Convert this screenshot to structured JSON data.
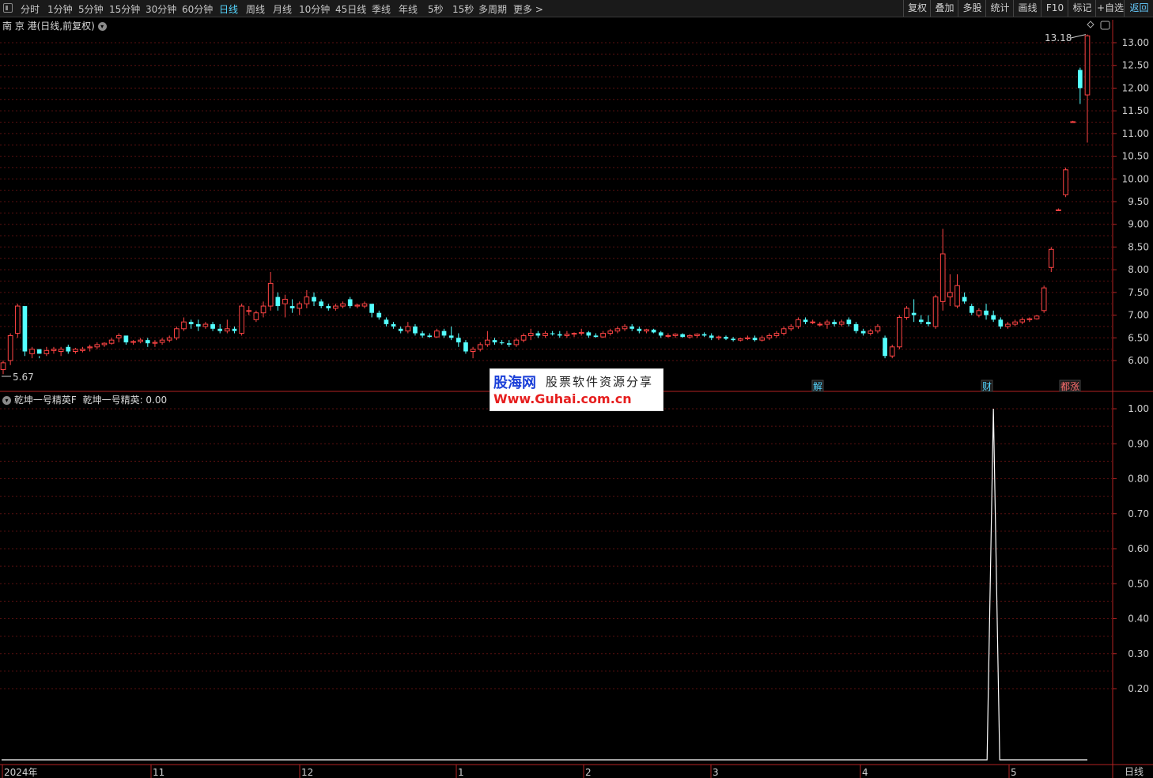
{
  "toolbar": {
    "periods": [
      "分时",
      "1分钟",
      "5分钟",
      "15分钟",
      "30分钟",
      "60分钟",
      "日线",
      "周线",
      "月线",
      "10分钟",
      "45日线",
      "季线",
      "年线",
      "5秒",
      "15秒",
      "多周期",
      "更多 >"
    ],
    "active_period": "日线",
    "right_buttons": [
      "复权",
      "叠加",
      "多股",
      "统计",
      "画线",
      "F10",
      "标记",
      "+自选",
      "返回"
    ]
  },
  "main_chart": {
    "stock_title": "南 京 港(日线,前复权)",
    "high_label": "13.18",
    "low_label": "5.67",
    "markers": [
      "解",
      "财",
      "都涨"
    ],
    "price_scale": [
      "13.00",
      "12.50",
      "12.00",
      "11.50",
      "11.00",
      "10.50",
      "10.00",
      "9.50",
      "9.00",
      "8.50",
      "8.00",
      "7.50",
      "7.00",
      "6.50",
      "6.00"
    ]
  },
  "indicator": {
    "name": "乾坤一号精英F",
    "value_text": "乾坤一号精英: 0.00",
    "scale": [
      "1.00",
      "0.90",
      "0.80",
      "0.70",
      "0.60",
      "0.50",
      "0.40",
      "0.30",
      "0.20"
    ]
  },
  "time_axis": [
    "2024年",
    "11",
    "12",
    "1",
    "2",
    "3",
    "4",
    "5"
  ],
  "period_label": "日线",
  "watermark": {
    "logo": "股海网",
    "slogan": "股票软件资源分享",
    "url": "Www.Guhai.com.cn"
  },
  "colors": {
    "up": "#ff4444",
    "down": "#54ffff",
    "grid": "#5a1010",
    "border": "#b22222",
    "background": "#000000",
    "active_tab": "#55d6ff"
  },
  "chart_data": [
    {
      "type": "candlestick",
      "title": "南 京 港(日线,前复权)",
      "ylim": [
        5.8,
        13.3
      ],
      "x_ticks": [
        "2024年",
        "11",
        "12",
        "1",
        "2",
        "3",
        "4",
        "5"
      ],
      "candles": [
        [
          5.8,
          6.0,
          5.7,
          5.95
        ],
        [
          6.0,
          6.6,
          5.9,
          6.55
        ],
        [
          6.6,
          7.25,
          6.5,
          7.2
        ],
        [
          7.2,
          6.7,
          6.1,
          6.2
        ],
        [
          6.15,
          6.3,
          6.05,
          6.25
        ],
        [
          6.25,
          6.1,
          6.05,
          6.15
        ],
        [
          6.15,
          6.3,
          6.1,
          6.22
        ],
        [
          6.22,
          6.3,
          6.15,
          6.25
        ],
        [
          6.2,
          6.3,
          6.1,
          6.25
        ],
        [
          6.3,
          6.35,
          6.15,
          6.2
        ],
        [
          6.2,
          6.28,
          6.15,
          6.25
        ],
        [
          6.22,
          6.3,
          6.18,
          6.25
        ],
        [
          6.28,
          6.35,
          6.2,
          6.3
        ],
        [
          6.3,
          6.4,
          6.25,
          6.35
        ],
        [
          6.35,
          6.4,
          6.3,
          6.38
        ],
        [
          6.38,
          6.5,
          6.35,
          6.45
        ],
        [
          6.5,
          6.6,
          6.4,
          6.55
        ],
        [
          6.55,
          6.5,
          6.35,
          6.4
        ],
        [
          6.4,
          6.45,
          6.35,
          6.42
        ],
        [
          6.42,
          6.5,
          6.38,
          6.45
        ],
        [
          6.45,
          6.5,
          6.3,
          6.38
        ],
        [
          6.38,
          6.45,
          6.3,
          6.4
        ],
        [
          6.4,
          6.5,
          6.35,
          6.45
        ],
        [
          6.45,
          6.55,
          6.4,
          6.5
        ],
        [
          6.5,
          6.75,
          6.45,
          6.7
        ],
        [
          6.7,
          6.95,
          6.65,
          6.85
        ],
        [
          6.85,
          6.9,
          6.7,
          6.8
        ],
        [
          6.8,
          6.9,
          6.65,
          6.75
        ],
        [
          6.75,
          6.85,
          6.7,
          6.8
        ],
        [
          6.8,
          6.85,
          6.65,
          6.7
        ],
        [
          6.7,
          6.8,
          6.6,
          6.65
        ],
        [
          6.65,
          6.9,
          6.6,
          6.7
        ],
        [
          6.7,
          6.75,
          6.6,
          6.65
        ],
        [
          6.6,
          7.25,
          6.55,
          7.2
        ],
        [
          7.1,
          7.2,
          7.0,
          7.1
        ],
        [
          6.9,
          7.1,
          6.85,
          7.05
        ],
        [
          7.05,
          7.3,
          6.95,
          7.2
        ],
        [
          7.2,
          7.95,
          7.1,
          7.7
        ],
        [
          7.4,
          7.5,
          7.1,
          7.2
        ],
        [
          7.25,
          7.45,
          6.95,
          7.35
        ],
        [
          7.2,
          7.35,
          7.05,
          7.15
        ],
        [
          7.15,
          7.3,
          7.0,
          7.25
        ],
        [
          7.25,
          7.55,
          7.15,
          7.4
        ],
        [
          7.4,
          7.5,
          7.2,
          7.3
        ],
        [
          7.3,
          7.35,
          7.15,
          7.2
        ],
        [
          7.2,
          7.25,
          7.1,
          7.15
        ],
        [
          7.15,
          7.25,
          7.1,
          7.2
        ],
        [
          7.2,
          7.3,
          7.15,
          7.25
        ],
        [
          7.35,
          7.4,
          7.15,
          7.2
        ],
        [
          7.2,
          7.25,
          7.15,
          7.22
        ],
        [
          7.2,
          7.3,
          7.15,
          7.25
        ],
        [
          7.25,
          7.2,
          6.95,
          7.05
        ],
        [
          7.05,
          7.1,
          6.9,
          6.95
        ],
        [
          6.9,
          6.95,
          6.75,
          6.8
        ],
        [
          6.8,
          6.85,
          6.7,
          6.75
        ],
        [
          6.7,
          6.75,
          6.6,
          6.65
        ],
        [
          6.65,
          6.85,
          6.6,
          6.75
        ],
        [
          6.75,
          6.8,
          6.55,
          6.6
        ],
        [
          6.6,
          6.65,
          6.5,
          6.55
        ],
        [
          6.55,
          6.6,
          6.5,
          6.52
        ],
        [
          6.52,
          6.7,
          6.5,
          6.65
        ],
        [
          6.65,
          6.7,
          6.5,
          6.55
        ],
        [
          6.55,
          6.75,
          6.45,
          6.5
        ],
        [
          6.5,
          6.6,
          6.3,
          6.4
        ],
        [
          6.4,
          6.45,
          6.15,
          6.2
        ],
        [
          6.2,
          6.3,
          6.05,
          6.25
        ],
        [
          6.25,
          6.4,
          6.2,
          6.35
        ],
        [
          6.35,
          6.65,
          6.3,
          6.45
        ],
        [
          6.45,
          6.5,
          6.35,
          6.4
        ],
        [
          6.4,
          6.45,
          6.35,
          6.38
        ],
        [
          6.38,
          6.45,
          6.3,
          6.35
        ],
        [
          6.35,
          6.5,
          6.3,
          6.45
        ],
        [
          6.45,
          6.6,
          6.4,
          6.55
        ],
        [
          6.55,
          6.7,
          6.45,
          6.6
        ],
        [
          6.6,
          6.65,
          6.5,
          6.55
        ],
        [
          6.55,
          6.65,
          6.5,
          6.6
        ],
        [
          6.6,
          6.65,
          6.55,
          6.58
        ],
        [
          6.58,
          6.65,
          6.5,
          6.55
        ],
        [
          6.55,
          6.65,
          6.5,
          6.58
        ],
        [
          6.58,
          6.62,
          6.52,
          6.6
        ],
        [
          6.6,
          6.7,
          6.55,
          6.62
        ],
        [
          6.62,
          6.65,
          6.5,
          6.55
        ],
        [
          6.55,
          6.6,
          6.5,
          6.52
        ],
        [
          6.52,
          6.65,
          6.5,
          6.6
        ],
        [
          6.6,
          6.7,
          6.55,
          6.65
        ],
        [
          6.65,
          6.75,
          6.6,
          6.7
        ],
        [
          6.7,
          6.8,
          6.65,
          6.75
        ],
        [
          6.75,
          6.8,
          6.65,
          6.7
        ],
        [
          6.7,
          6.75,
          6.6,
          6.65
        ],
        [
          6.65,
          6.7,
          6.6,
          6.68
        ],
        [
          6.68,
          6.7,
          6.6,
          6.62
        ],
        [
          6.62,
          6.65,
          6.5,
          6.55
        ],
        [
          6.55,
          6.6,
          6.5,
          6.55
        ],
        [
          6.55,
          6.6,
          6.5,
          6.58
        ],
        [
          6.58,
          6.6,
          6.5,
          6.52
        ],
        [
          6.52,
          6.58,
          6.48,
          6.55
        ],
        [
          6.55,
          6.6,
          6.5,
          6.58
        ],
        [
          6.58,
          6.62,
          6.52,
          6.55
        ],
        [
          6.55,
          6.6,
          6.45,
          6.5
        ],
        [
          6.5,
          6.55,
          6.45,
          6.52
        ],
        [
          6.52,
          6.55,
          6.45,
          6.48
        ],
        [
          6.48,
          6.52,
          6.42,
          6.45
        ],
        [
          6.45,
          6.5,
          6.42,
          6.48
        ],
        [
          6.48,
          6.55,
          6.45,
          6.5
        ],
        [
          6.5,
          6.55,
          6.42,
          6.45
        ],
        [
          6.45,
          6.55,
          6.42,
          6.5
        ],
        [
          6.5,
          6.6,
          6.45,
          6.55
        ],
        [
          6.55,
          6.65,
          6.5,
          6.6
        ],
        [
          6.6,
          6.75,
          6.55,
          6.7
        ],
        [
          6.7,
          6.8,
          6.65,
          6.75
        ],
        [
          6.75,
          6.95,
          6.7,
          6.9
        ],
        [
          6.9,
          6.95,
          6.8,
          6.85
        ],
        [
          6.85,
          6.9,
          6.8,
          6.85
        ],
        [
          6.8,
          6.85,
          6.75,
          6.8
        ],
        [
          6.8,
          6.9,
          6.7,
          6.85
        ],
        [
          6.85,
          6.9,
          6.75,
          6.8
        ],
        [
          6.8,
          6.9,
          6.75,
          6.85
        ],
        [
          6.9,
          6.95,
          6.75,
          6.8
        ],
        [
          6.8,
          6.85,
          6.6,
          6.65
        ],
        [
          6.65,
          6.7,
          6.55,
          6.6
        ],
        [
          6.6,
          6.7,
          6.55,
          6.65
        ],
        [
          6.65,
          6.8,
          6.6,
          6.75
        ],
        [
          6.5,
          6.55,
          6.05,
          6.1
        ],
        [
          6.1,
          6.35,
          6.05,
          6.3
        ],
        [
          6.3,
          7.0,
          6.25,
          6.95
        ],
        [
          6.95,
          7.2,
          6.9,
          7.15
        ],
        [
          7.05,
          7.35,
          6.85,
          7.0
        ],
        [
          6.9,
          7.0,
          6.8,
          6.85
        ],
        [
          6.85,
          7.0,
          6.75,
          6.8
        ],
        [
          6.75,
          7.45,
          6.7,
          7.4
        ],
        [
          7.3,
          8.9,
          7.1,
          8.35
        ],
        [
          7.4,
          7.9,
          7.2,
          7.5
        ],
        [
          7.2,
          7.9,
          7.15,
          7.65
        ],
        [
          7.4,
          7.5,
          7.25,
          7.3
        ],
        [
          7.2,
          7.25,
          7.0,
          7.05
        ],
        [
          7.0,
          7.15,
          6.95,
          7.1
        ],
        [
          7.1,
          7.25,
          6.9,
          7.0
        ],
        [
          7.0,
          7.1,
          6.85,
          6.9
        ],
        [
          6.9,
          6.95,
          6.7,
          6.75
        ],
        [
          6.75,
          6.85,
          6.7,
          6.8
        ],
        [
          6.8,
          6.9,
          6.75,
          6.85
        ],
        [
          6.85,
          6.95,
          6.8,
          6.9
        ],
        [
          6.9,
          6.95,
          6.85,
          6.92
        ],
        [
          6.92,
          7.0,
          6.9,
          6.98
        ],
        [
          7.1,
          7.65,
          7.05,
          7.6
        ],
        [
          8.05,
          8.5,
          7.95,
          8.45
        ],
        [
          9.3,
          9.35,
          9.3,
          9.32
        ],
        [
          9.65,
          10.25,
          9.6,
          10.2
        ],
        [
          11.25,
          11.28,
          11.25,
          11.26
        ],
        [
          12.4,
          12.45,
          11.65,
          12.0
        ],
        [
          11.85,
          13.18,
          10.8,
          13.15
        ]
      ]
    },
    {
      "type": "line",
      "title": "乾坤一号精英F",
      "ylim": [
        0,
        1.0
      ],
      "series": [
        {
          "name": "乾坤一号精英",
          "spike_index": 137,
          "spike_value": 1.0,
          "baseline": 0.0
        }
      ]
    }
  ]
}
